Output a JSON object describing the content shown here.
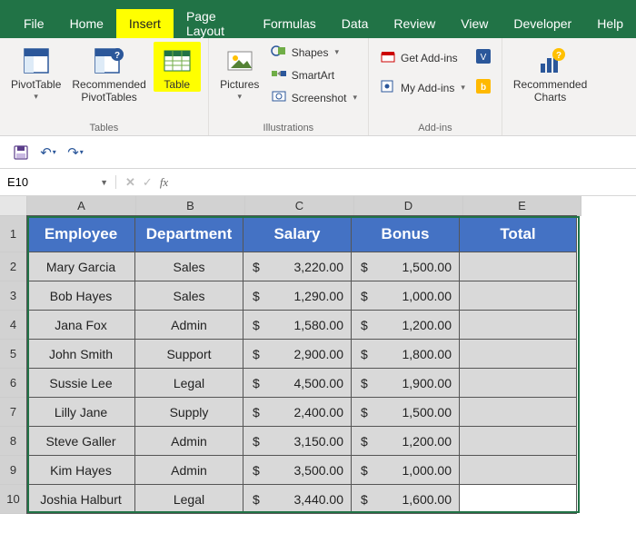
{
  "tabs": [
    "File",
    "Home",
    "Insert",
    "Page Layout",
    "Formulas",
    "Data",
    "Review",
    "View",
    "Developer",
    "Help"
  ],
  "active_tab": "Insert",
  "ribbon": {
    "tables": {
      "pivot": "PivotTable",
      "recpivot": "Recommended\nPivotTables",
      "table": "Table",
      "group": "Tables"
    },
    "illus": {
      "pictures": "Pictures",
      "shapes": "Shapes",
      "smartart": "SmartArt",
      "screenshot": "Screenshot",
      "group": "Illustrations"
    },
    "addins": {
      "get": "Get Add-ins",
      "my": "My Add-ins",
      "group": "Add-ins"
    },
    "charts": {
      "rec": "Recommended\nCharts"
    }
  },
  "name_box": "E10",
  "fx": "",
  "columns": [
    "A",
    "B",
    "C",
    "D",
    "E"
  ],
  "headers": {
    "emp": "Employee",
    "dep": "Department",
    "sal": "Salary",
    "bon": "Bonus",
    "tot": "Total"
  },
  "rows": [
    {
      "emp": "Mary Garcia",
      "dep": "Sales",
      "sal": "3,220.00",
      "bon": "1,500.00"
    },
    {
      "emp": "Bob Hayes",
      "dep": "Sales",
      "sal": "1,290.00",
      "bon": "1,000.00"
    },
    {
      "emp": "Jana Fox",
      "dep": "Admin",
      "sal": "1,580.00",
      "bon": "1,200.00"
    },
    {
      "emp": "John Smith",
      "dep": "Support",
      "sal": "2,900.00",
      "bon": "1,800.00"
    },
    {
      "emp": "Sussie Lee",
      "dep": "Legal",
      "sal": "4,500.00",
      "bon": "1,900.00"
    },
    {
      "emp": "Lilly Jane",
      "dep": "Supply",
      "sal": "2,400.00",
      "bon": "1,500.00"
    },
    {
      "emp": "Steve Galler",
      "dep": "Admin",
      "sal": "3,150.00",
      "bon": "1,200.00"
    },
    {
      "emp": "Kim Hayes",
      "dep": "Admin",
      "sal": "3,500.00",
      "bon": "1,000.00"
    },
    {
      "emp": "Joshia Halburt",
      "dep": "Legal",
      "sal": "3,440.00",
      "bon": "1,600.00"
    }
  ],
  "dollar": "$"
}
